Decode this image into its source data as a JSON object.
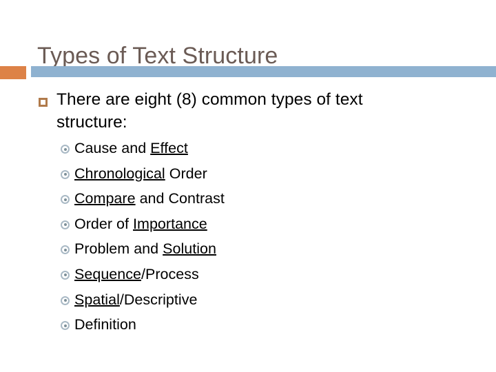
{
  "slide": {
    "title": "Types of Text Structure",
    "theme": {
      "title_color": "#6B5B55",
      "accent_bar_color": "#DD8247",
      "main_bar_color": "#8FB2D0",
      "level1_bullet_color": "#B07A4A",
      "level2_bullet_color": "#A9B9C5",
      "body_text_color": "#000000",
      "background_color": "#FFFFFF"
    },
    "body": {
      "level1": {
        "bullet_glyph": "hollow-square",
        "text": "There are eight (8) common types of text structure:"
      },
      "level2": {
        "bullet_glyph": "fisheye-circle",
        "items": [
          {
            "full_text": "Cause and Effect",
            "parts": [
              {
                "text": "Cause and ",
                "underline": false
              },
              {
                "text": "Effect",
                "underline": true
              }
            ]
          },
          {
            "full_text": "Chronological Order",
            "parts": [
              {
                "text": "Chronological",
                "underline": true
              },
              {
                "text": " Order",
                "underline": false
              }
            ]
          },
          {
            "full_text": "Compare and Contrast",
            "parts": [
              {
                "text": "Compare",
                "underline": true
              },
              {
                "text": " and Contrast",
                "underline": false
              }
            ]
          },
          {
            "full_text": "Order of Importance",
            "parts": [
              {
                "text": "Order of ",
                "underline": false
              },
              {
                "text": "Importance",
                "underline": true
              }
            ]
          },
          {
            "full_text": "Problem and Solution",
            "parts": [
              {
                "text": "Problem and ",
                "underline": false
              },
              {
                "text": "Solution",
                "underline": true
              }
            ]
          },
          {
            "full_text": "Sequence/Process",
            "parts": [
              {
                "text": "Sequence",
                "underline": true
              },
              {
                "text": "/Process",
                "underline": false
              }
            ]
          },
          {
            "full_text": "Spatial/Descriptive",
            "parts": [
              {
                "text": "Spatial",
                "underline": true
              },
              {
                "text": "/Descriptive",
                "underline": false
              }
            ]
          },
          {
            "full_text": "Definition",
            "parts": [
              {
                "text": "Definition",
                "underline": false
              }
            ]
          }
        ]
      }
    }
  }
}
